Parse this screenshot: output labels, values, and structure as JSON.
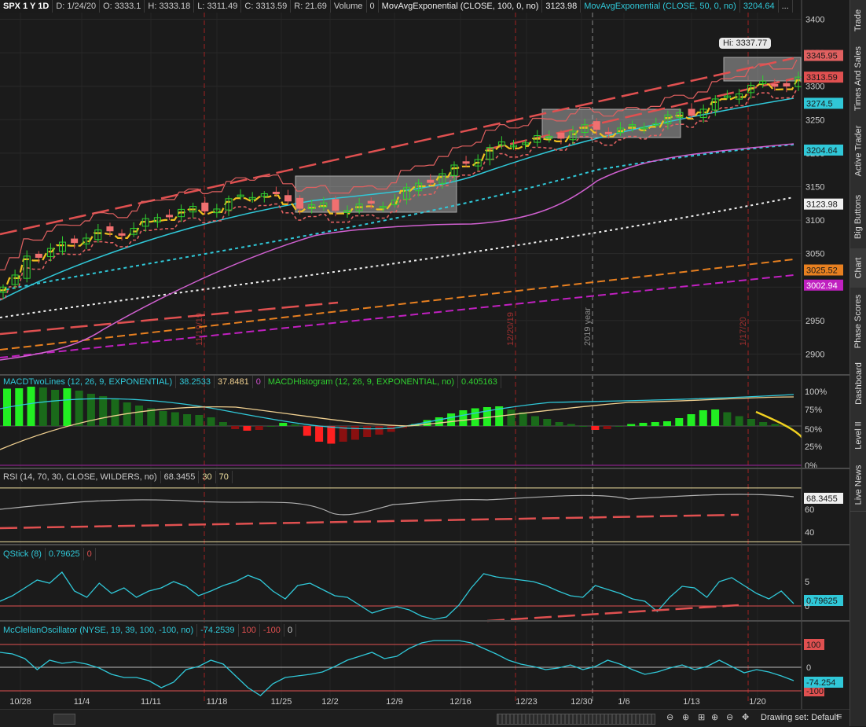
{
  "header": {
    "symbol": "SPX 1 Y 1D",
    "date": "D: 1/24/20",
    "open": "O: 3333.1",
    "high": "H: 3333.18",
    "low": "L: 3311.49",
    "close": "C: 3313.59",
    "range": "R: 21.69",
    "volume_label": "Volume",
    "volume_value": "0",
    "ma100_label": "MovAvgExponential (CLOSE, 100, 0, no)",
    "ma100_value": "3123.98",
    "ma50_label": "MovAvgExponential (CLOSE, 50, 0, no)",
    "ma50_value": "3204.64",
    "more": "..."
  },
  "price_axis": {
    "ticks": [
      "3400",
      "3350",
      "3300",
      "3250",
      "3200",
      "3150",
      "3100",
      "3050",
      "3000",
      "2950",
      "2900"
    ],
    "badges": [
      {
        "label": "3345.95",
        "value": 3345.95,
        "bg": "#e06060",
        "fg": "#1b1b1b"
      },
      {
        "label": "3313.59",
        "value": 3313.59,
        "bg": "#e05050",
        "fg": "#1b1b1b"
      },
      {
        "label": "3274.5",
        "value": 3274.5,
        "bg": "#30c8d8",
        "fg": "#1b1b1b"
      },
      {
        "label": "3204.64",
        "value": 3204.64,
        "bg": "#30c8d8",
        "fg": "#1b1b1b"
      },
      {
        "label": "3123.98",
        "value": 3123.98,
        "bg": "#f0f0f0",
        "fg": "#1b1b1b"
      },
      {
        "label": "3025.52",
        "value": 3025.52,
        "bg": "#e88020",
        "fg": "#1b1b1b"
      },
      {
        "label": "3002.94",
        "value": 3002.94,
        "bg": "#c020c0",
        "fg": "#ffffff"
      }
    ],
    "hi_label": "Hi: 3337.77"
  },
  "event_markers": [
    "11/19/19",
    "12/20/19",
    "2019 year",
    "1/17/20"
  ],
  "macd": {
    "title": "MACDTwoLines (12, 26, 9, EXPONENTIAL)",
    "v1": "38.2533",
    "v2": "37.8481",
    "v3": "0",
    "hist_title": "MACDHistogram (12, 26, 9, EXPONENTIAL, no)",
    "hist_value": "0.405163",
    "ticks": [
      "100%",
      "75%",
      "50%",
      "25%",
      "0%"
    ]
  },
  "rsi": {
    "title": "RSI (14, 70, 30, CLOSE, WILDERS, no)",
    "value": "68.3455",
    "os": "30",
    "ob": "70",
    "ticks": [
      "60",
      "40"
    ]
  },
  "qstick": {
    "title": "QStick (8)",
    "value": "0.79625",
    "zero": "0",
    "ticks": [
      "5",
      "0"
    ]
  },
  "mcclellan": {
    "title": "McClellanOscillator (NYSE, 19, 39, 100, -100, no)",
    "value": "-74.2539",
    "upper": "100",
    "lower": "-100",
    "zero": "0",
    "ticks": [
      "100",
      "0",
      "-100"
    ],
    "badge": "-74.254"
  },
  "x_axis": [
    "10/28",
    "11/4",
    "11/11",
    "11/18",
    "11/25",
    "12/2",
    "12/9",
    "12/16",
    "12/23",
    "12/30",
    "1/6",
    "1/13",
    "1/20"
  ],
  "sidebar_tabs": [
    "Trade",
    "Times And Sales",
    "Active Trader",
    "Big Buttons",
    "Chart",
    "Phase Scores",
    "Dashboard",
    "Level II",
    "Live News"
  ],
  "status": {
    "drawing_set": "Drawing set: Default"
  },
  "chart_data": {
    "type": "line",
    "title": "",
    "x": [
      "10/28",
      "11/4",
      "11/11",
      "11/18",
      "11/25",
      "12/2",
      "12/9",
      "12/16",
      "12/23",
      "12/30",
      "1/6",
      "1/13",
      "1/20"
    ],
    "series": [
      {
        "name": "",
        "values": [
          3039,
          3066,
          3093,
          3120,
          3140,
          3113,
          3135,
          3191,
          3224,
          3235,
          3247,
          3289,
          3313
        ]
      }
    ],
    "ylim": [
      2870,
      3410
    ]
  }
}
